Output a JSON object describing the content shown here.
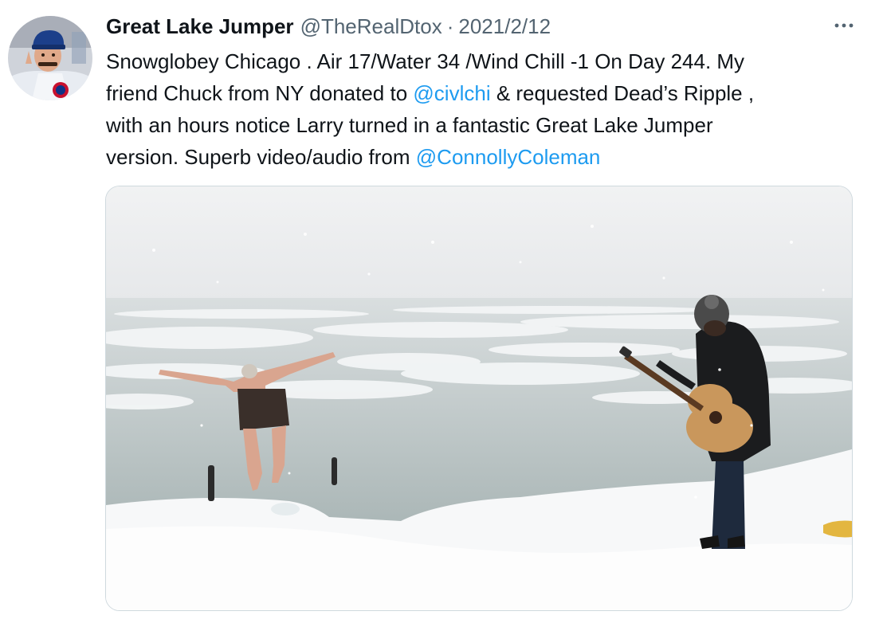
{
  "tweet": {
    "display_name": "Great Lake Jumper",
    "handle": "@TheRealDtox",
    "separator": "·",
    "date": "2021/2/12",
    "more_icon": "more-horizontal-icon",
    "text": {
      "line1": "Snowglobey Chicago . Air 17/Water 34 /Wind Chill -1 On Day 244. My",
      "line2_before": "friend Chuck from NY donated to ",
      "line2_mention": "@civlchi",
      "line2_after": " & requested Dead’s Ripple ,",
      "line3": "with an hours notice Larry turned in a fantastic Great Lake Jumper",
      "line4_before": "version. Superb video/audio from ",
      "line4_mention": "@ConnollyColeman"
    },
    "media": {
      "kind": "video-thumbnail"
    }
  },
  "colors": {
    "link": "#1d9bf0",
    "secondary_text": "#536471",
    "primary_text": "#0f1419",
    "border": "#cfd9de"
  }
}
